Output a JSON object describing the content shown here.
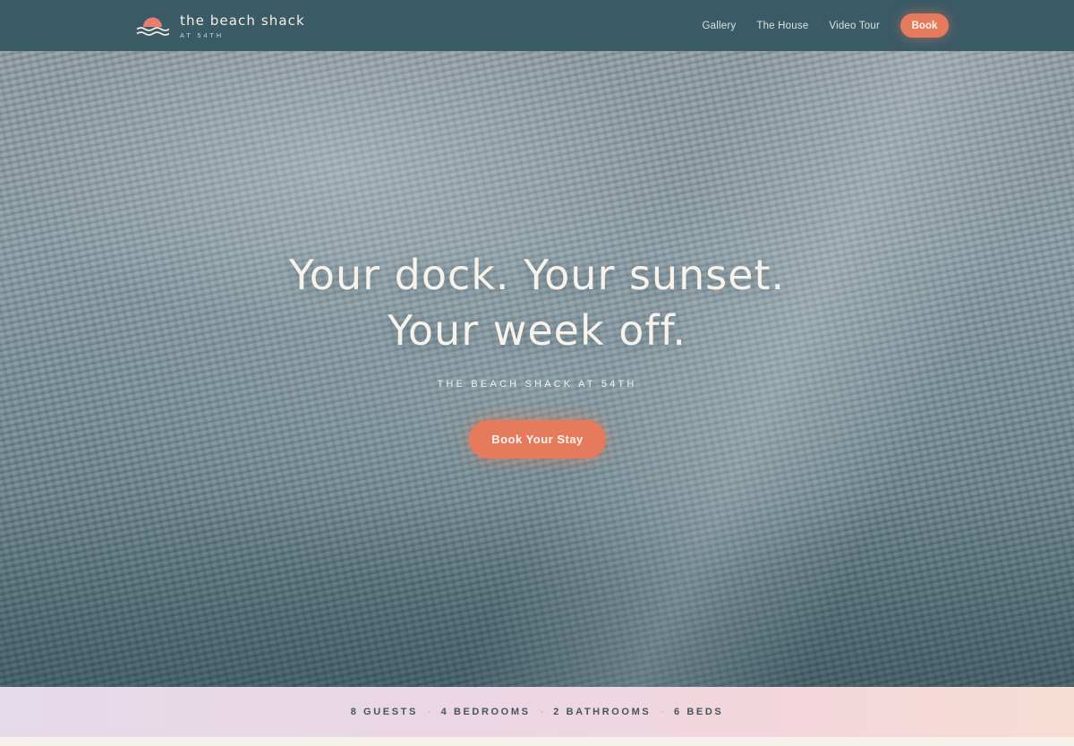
{
  "nav": {
    "brand_name": "the beach shack",
    "brand_sub": "AT 54TH",
    "links": [
      "Gallery",
      "The House",
      "Video Tour"
    ],
    "book_label": "Book"
  },
  "hero": {
    "headline_line1": "Your dock. Your sunset.",
    "headline_line2": "Your week off.",
    "subtitle": "THE BEACH SHACK AT 54TH",
    "cta_label": "Book Your Stay"
  },
  "stats": {
    "items": [
      "8 GUESTS",
      "4 BEDROOMS",
      "2 BATHROOMS",
      "6 BEDS"
    ],
    "separator": "·"
  },
  "colors": {
    "nav_bg": "#3a5a66",
    "accent": "#e57b5c",
    "headline": "#f7f2ea",
    "stats_text": "#45565e"
  },
  "icons": {
    "logo": "sunset-waves-icon"
  }
}
